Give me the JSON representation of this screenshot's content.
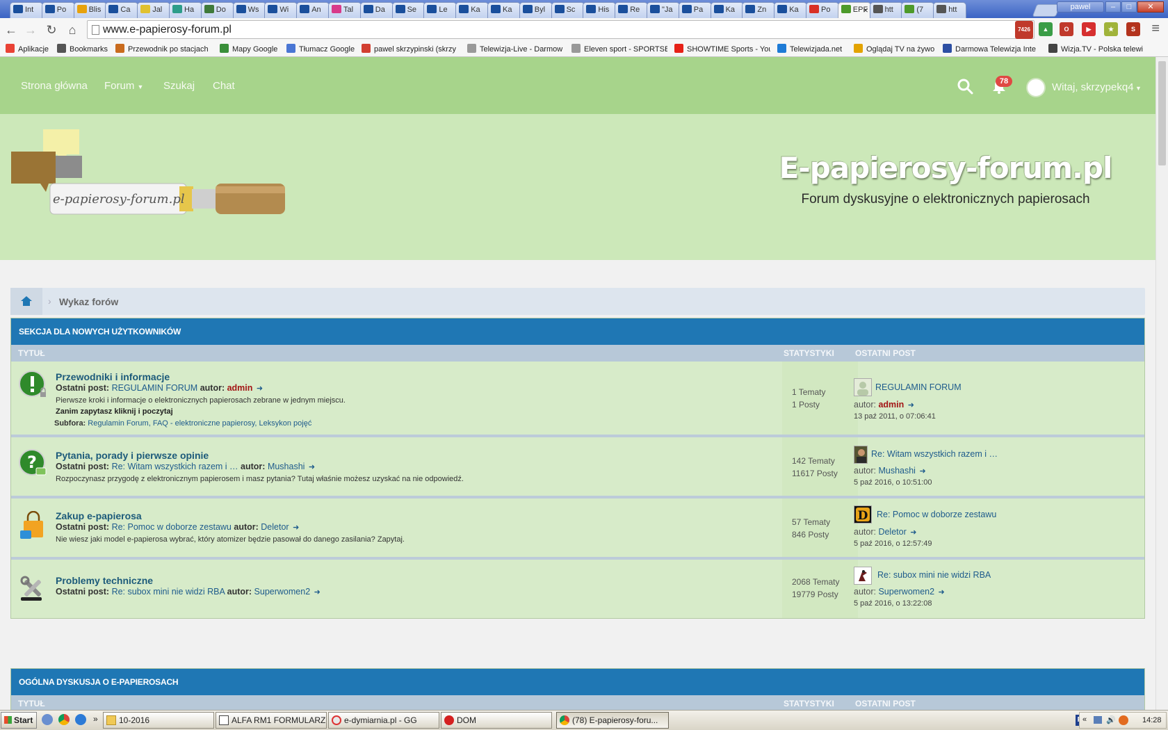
{
  "browser": {
    "tabs": [
      {
        "label": "Int",
        "fav": "int"
      },
      {
        "label": "Po",
        "fav": "int"
      },
      {
        "label": "Blis",
        "fav": "TV"
      },
      {
        "label": "Ca",
        "fav": "int"
      },
      {
        "label": "Jal",
        "fav": "T"
      },
      {
        "label": "Ha",
        "fav": "ha"
      },
      {
        "label": "Do",
        "fav": "do"
      },
      {
        "label": "Ws",
        "fav": "int"
      },
      {
        "label": "Wi",
        "fav": "int"
      },
      {
        "label": "An",
        "fav": "int"
      },
      {
        "label": "Tal",
        "fav": "ta"
      },
      {
        "label": "Da",
        "fav": "int"
      },
      {
        "label": "Se",
        "fav": "int"
      },
      {
        "label": "Le",
        "fav": "int"
      },
      {
        "label": "Ka",
        "fav": "int"
      },
      {
        "label": "Ka",
        "fav": "int"
      },
      {
        "label": "Byl",
        "fav": "int"
      },
      {
        "label": "Sc",
        "fav": "int"
      },
      {
        "label": "His",
        "fav": "int"
      },
      {
        "label": "Re",
        "fav": "int"
      },
      {
        "label": "\"Ja",
        "fav": "int"
      },
      {
        "label": "Pa",
        "fav": "int"
      },
      {
        "label": "Ka",
        "fav": "int"
      },
      {
        "label": "Zn",
        "fav": "int"
      },
      {
        "label": "Ka",
        "fav": "int"
      },
      {
        "label": "Po",
        "fav": "M"
      },
      {
        "label": "EPF",
        "fav": "EPF"
      },
      {
        "label": "htt",
        "fav": "S"
      },
      {
        "label": "(7",
        "fav": "EPF"
      },
      {
        "label": "htt",
        "fav": "S"
      }
    ],
    "tab_fav_text": "int",
    "profile_name": "pawel",
    "address": "www.e-papierosy-forum.pl",
    "gmail_count": "7426",
    "bookmarks": [
      {
        "label": "Aplikacje",
        "color": "#e94235"
      },
      {
        "label": "Bookmarks",
        "color": "#555555"
      },
      {
        "label": "Przewodnik po stacjach",
        "color": "#c96b1e"
      },
      {
        "label": "Mapy Google",
        "color": "#3a8f3a"
      },
      {
        "label": "Tłumacz Google",
        "color": "#4a76d4"
      },
      {
        "label": "pawel skrzypinski (skrzy",
        "color": "#d23f31"
      },
      {
        "label": "Telewizja-Live - Darmow",
        "color": "#999999"
      },
      {
        "label": "Eleven sport - SPORTSB",
        "color": "#999999"
      },
      {
        "label": "SHOWTIME Sports - You",
        "color": "#e62117"
      },
      {
        "label": "Telewizjada.net",
        "color": "#1e7bd6"
      },
      {
        "label": "Oglądaj TV na żywo",
        "color": "#e3a300"
      },
      {
        "label": "Darmowa Telewizja Inte",
        "color": "#2d4fa3"
      },
      {
        "label": "Wizja.TV - Polska telewi",
        "color": "#444444"
      }
    ]
  },
  "site": {
    "nav": {
      "home": "Strona główna",
      "forum": "Forum",
      "search": "Szukaj",
      "chat": "Chat",
      "notifications": "78",
      "user_greeting": "Witaj, skrzypekq4"
    },
    "banner": {
      "title": "E-papierosy-forum.pl",
      "subtitle": "Forum dyskusyjne o elektronicznych papierosach",
      "logo_text": "e-papierosy-forum.pl"
    },
    "breadcrumb": {
      "current": "Wykaz forów"
    },
    "columns": {
      "title": "TYTUŁ",
      "stats": "STATYSTYKI",
      "last_post": "OSTATNI POST"
    },
    "labels": {
      "last_post": "Ostatni post:",
      "author": "autor:",
      "subforums": "Subfora:"
    },
    "categories": [
      {
        "title": "SEKCJA DLA NOWYCH UŻYTKOWNIKÓW",
        "forums": [
          {
            "name": "Przewodniki i informacje",
            "last_post_title": "REGULAMIN FORUM",
            "last_post_author": "admin",
            "description": "Pierwsze kroki i informacje o elektronicznych papierosach zebrane w jednym miejscu.",
            "note": "Zanim zapytasz kliknij i poczytaj",
            "subforums": [
              "Regulamin Forum",
              "FAQ - elektroniczne papierosy",
              "Leksykon pojęć"
            ],
            "topics": "1 Tematy",
            "posts": "1 Posty",
            "lp_title": "REGULAMIN FORUM",
            "lp_author": "admin",
            "lp_date": "13 paź 2011, o 07:06:41"
          },
          {
            "name": "Pytania, porady i pierwsze opinie",
            "last_post_title": "Re: Witam wszystkich razem i …",
            "last_post_author": "Mushashi",
            "description": "Rozpoczynasz przygodę z elektronicznym papierosem i masz pytania? Tutaj właśnie możesz uzyskać na nie odpowiedź.",
            "topics": "142 Tematy",
            "posts": "11617 Posty",
            "lp_title": "Re: Witam wszystkich razem i …",
            "lp_author": "Mushashi",
            "lp_date": "5 paź 2016, o 10:51:00"
          },
          {
            "name": "Zakup e-papierosa",
            "last_post_title": "Re: Pomoc w doborze zestawu",
            "last_post_author": "Deletor",
            "description": "Nie wiesz jaki model e-papierosa wybrać, który atomizer będzie pasował do danego zasilania? Zapytaj.",
            "topics": "57 Tematy",
            "posts": "846 Posty",
            "lp_title": "Re: Pomoc w doborze zestawu",
            "lp_author": "Deletor",
            "lp_date": "5 paź 2016, o 12:57:49"
          },
          {
            "name": "Problemy techniczne",
            "last_post_title": "Re: subox mini nie widzi RBA",
            "last_post_author": "Superwomen2",
            "topics": "2068 Tematy",
            "posts": "19779 Posty",
            "lp_title": "Re: subox mini nie widzi RBA",
            "lp_author": "Superwomen2",
            "lp_date": "5 paź 2016, o 13:22:08"
          }
        ]
      },
      {
        "title": "OGÓLNA DYSKUSJA O E-PAPIEROSACH",
        "forums": []
      }
    ]
  },
  "taskbar": {
    "start": "Start",
    "tasks": [
      "10-2016",
      "ALFA RM1 FORMULARZ ...",
      "e-dymiarnia.pl - GG",
      "DOM",
      "(78) E-papierosy-foru..."
    ],
    "lang": "PL",
    "clock": "14:28"
  },
  "colors": {
    "nav_green": "#a7d48b",
    "banner_green": "#cce8b9",
    "category_blue": "#1f77b4",
    "row_green": "#d7ebc9",
    "link_blue": "#1e5b8c",
    "admin_red": "#a31515",
    "badge_red": "#e04843"
  }
}
